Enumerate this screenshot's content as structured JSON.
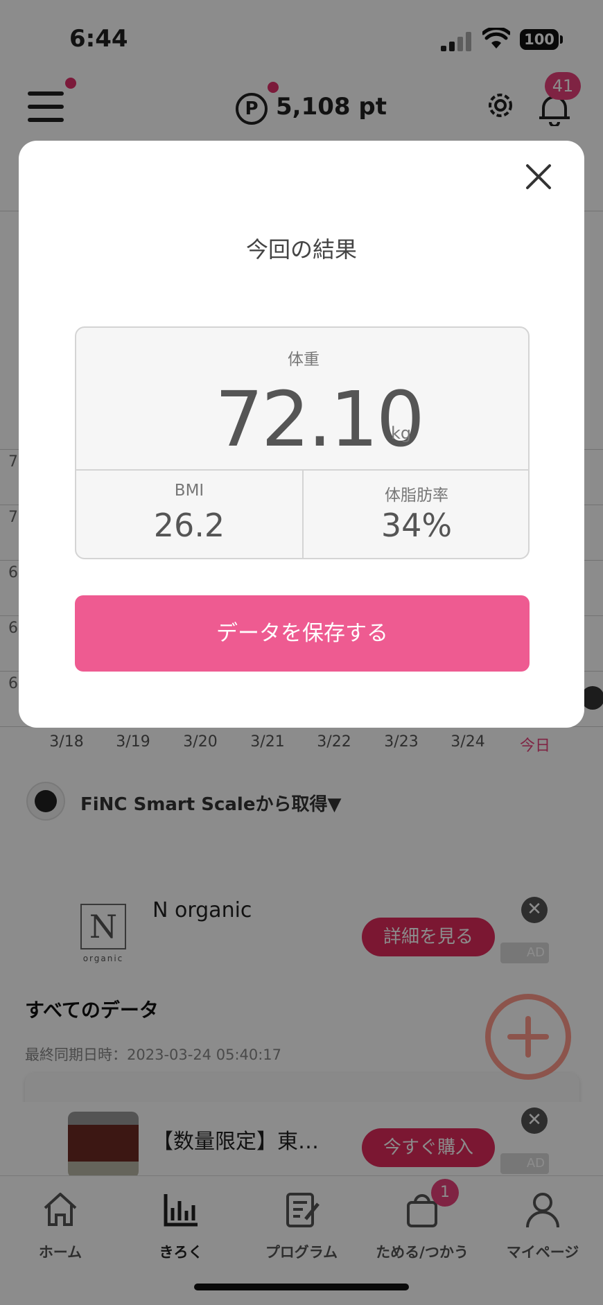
{
  "status_bar": {
    "time": "6:44",
    "battery": "100"
  },
  "header": {
    "points_symbol": "P",
    "points": "5,108 pt",
    "notification_count": "41"
  },
  "chart": {
    "y_labels": [
      "7",
      "7",
      "6",
      "6",
      "6"
    ],
    "x_labels": [
      "3/18",
      "3/19",
      "3/20",
      "3/21",
      "3/22",
      "3/23",
      "3/24",
      "今日"
    ]
  },
  "source": {
    "text": "FiNC Smart Scaleから取得▼"
  },
  "ads": [
    {
      "logo": "N",
      "logo_sub": "organic",
      "title": "N organic",
      "cta": "詳細を見る",
      "badge": "AD",
      "close": "✕"
    },
    {
      "title": "【数量限定】東…",
      "cta": "今すぐ購入",
      "badge": "AD",
      "close": "✕"
    }
  ],
  "all_data": {
    "title": "すべてのデータ",
    "last_sync": "最終同期日時：2023-03-24 05:40:17"
  },
  "tabs": [
    {
      "label": "ホーム",
      "icon": "home-icon"
    },
    {
      "label": "きろく",
      "icon": "chart-icon",
      "active": true
    },
    {
      "label": "プログラム",
      "icon": "program-icon"
    },
    {
      "label": "ためる/つかう",
      "icon": "shopping-bag-icon",
      "badge": "1"
    },
    {
      "label": "マイページ",
      "icon": "person-icon"
    }
  ],
  "modal": {
    "title": "今回の結果",
    "weight_label": "体重",
    "weight_value": "72.10",
    "weight_unit": "kg",
    "bmi_label": "BMI",
    "bmi_value": "26.2",
    "fat_label": "体脂肪率",
    "fat_value": "34%",
    "save_label": "データを保存する"
  },
  "colors": {
    "accent": "#ee5b91",
    "badge": "#e8417a",
    "ad_cta": "#e02a5c"
  }
}
